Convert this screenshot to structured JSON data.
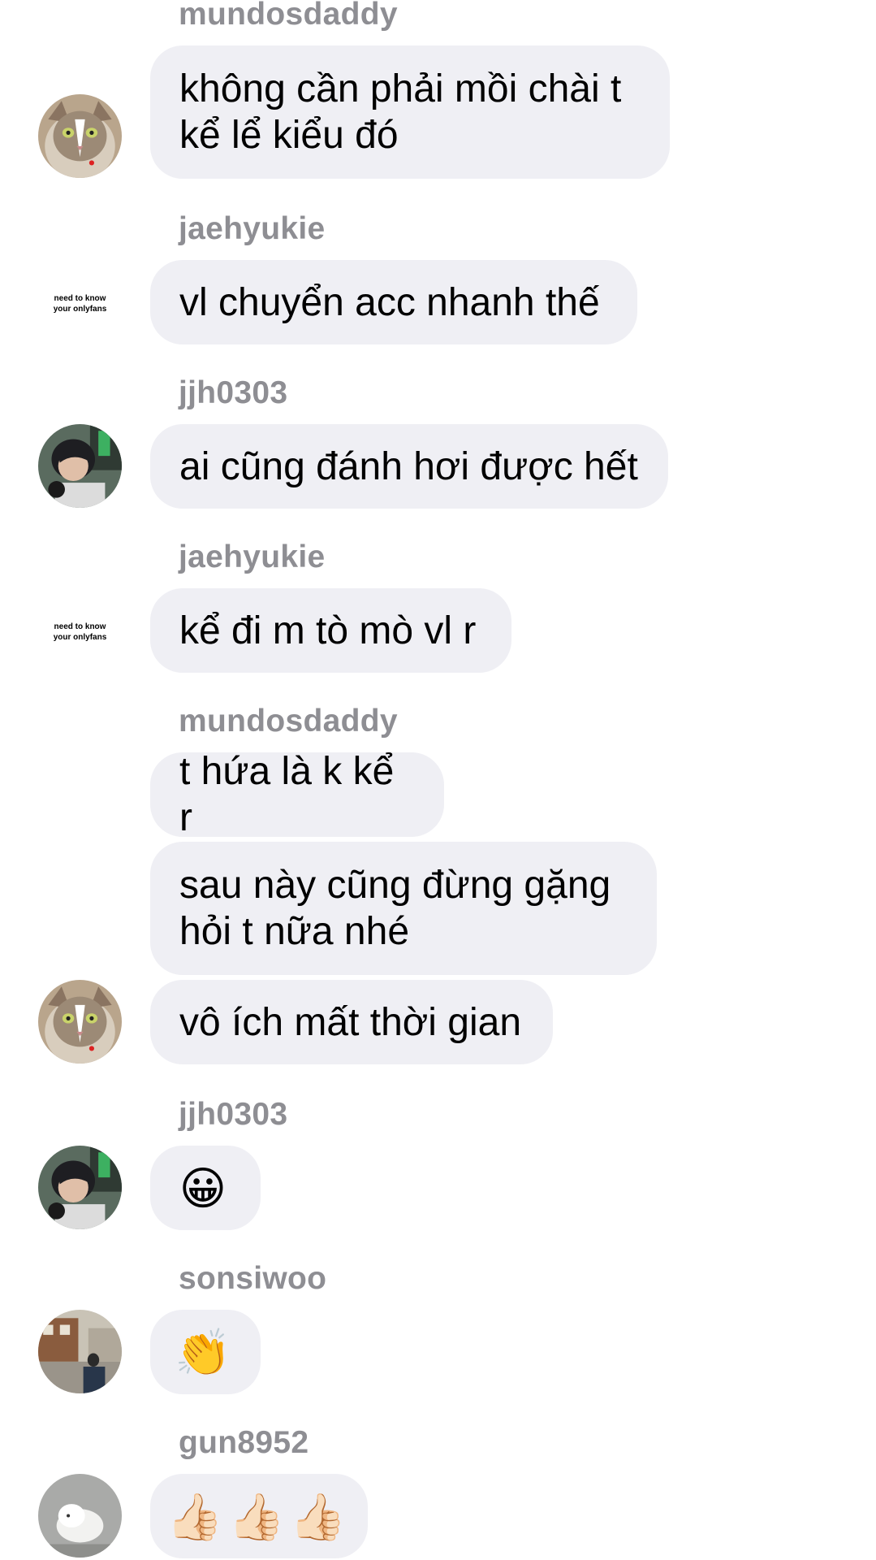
{
  "messages": [
    {
      "sender": "mundosdaddy",
      "text": "không cần phải mồi chài t\nkể lể kiểu đó"
    },
    {
      "sender": "jaehyukie",
      "text": "vl chuyển acc nhanh thế"
    },
    {
      "sender": "jjh0303",
      "text": "ai cũng đánh hơi được hết"
    },
    {
      "sender": "jaehyukie",
      "text": "kể đi m tò mò vl r"
    },
    {
      "sender": "mundosdaddy",
      "texts": [
        "t hứa là k kể r",
        "sau này cũng đừng gặng\nhỏi t nữa nhé",
        "vô ích mất thời gian"
      ]
    },
    {
      "sender": "jjh0303",
      "text": "😀"
    },
    {
      "sender": "sonsiwoo",
      "text": "👏"
    },
    {
      "sender": "gun8952",
      "text": "👍🏻👍🏻👍🏻"
    }
  ],
  "avatar_text": {
    "line1": "need to know",
    "line2": "your onlyfans"
  },
  "colors": {
    "bubble": "#efeff4",
    "username": "#8e8e93",
    "background": "#ffffff"
  }
}
